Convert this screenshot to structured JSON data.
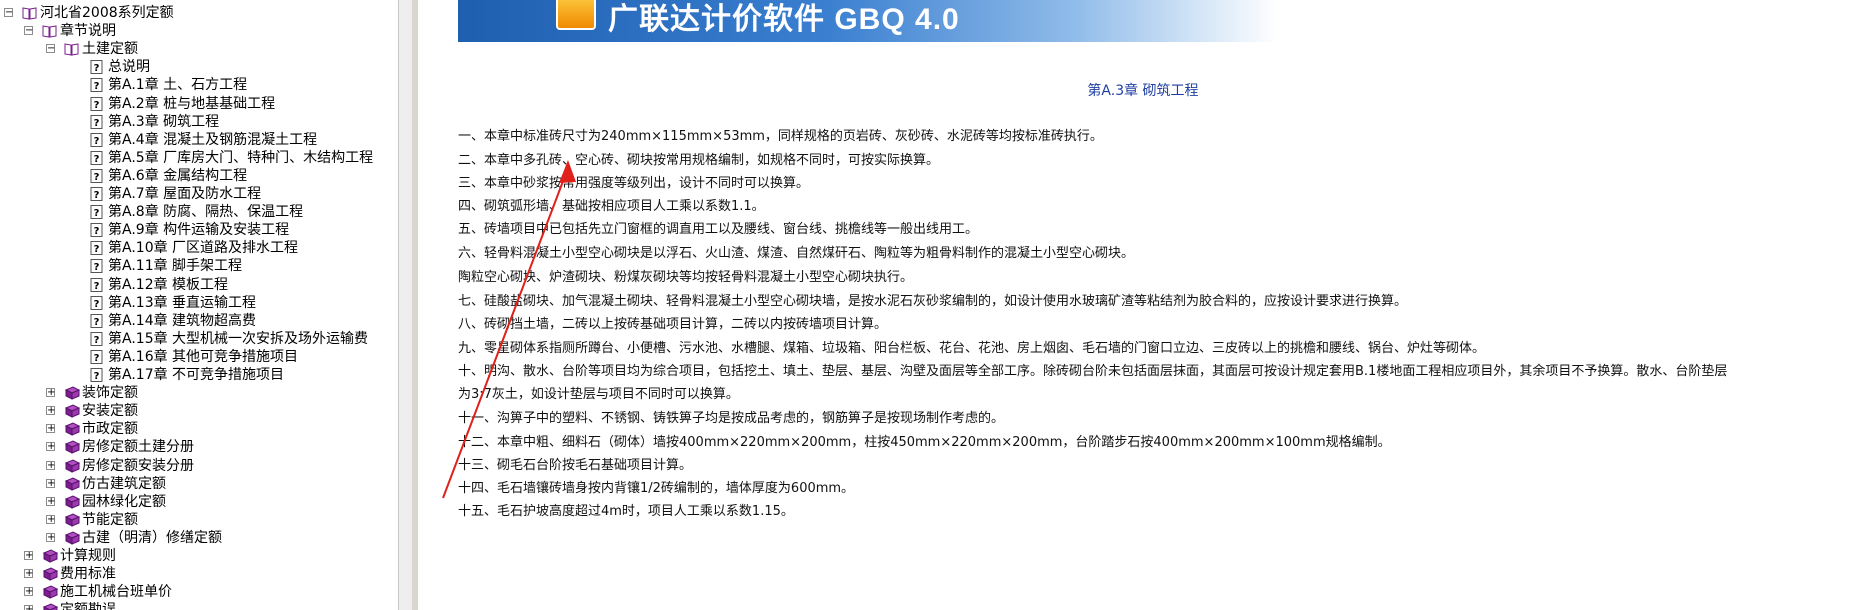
{
  "tree": {
    "items": [
      {
        "label": "河北省2008系列定额",
        "level": 0,
        "expander": "⊟",
        "icon": "book-open-icon"
      },
      {
        "label": "章节说明",
        "level": 1,
        "expander": "⊟",
        "icon": "book-open-icon"
      },
      {
        "label": "土建定额",
        "level": 2,
        "expander": "⊟",
        "icon": "book-open-icon"
      },
      {
        "label": "总说明",
        "level": 3,
        "expander": "",
        "icon": "help-page-icon"
      },
      {
        "label": "第A.1章 土、石方工程",
        "level": 3,
        "expander": "",
        "icon": "help-page-icon"
      },
      {
        "label": "第A.2章 桩与地基基础工程",
        "level": 3,
        "expander": "",
        "icon": "help-page-icon"
      },
      {
        "label": "第A.3章 砌筑工程",
        "level": 3,
        "expander": "",
        "icon": "help-page-icon"
      },
      {
        "label": "第A.4章 混凝土及钢筋混凝土工程",
        "level": 3,
        "expander": "",
        "icon": "help-page-icon"
      },
      {
        "label": "第A.5章 厂库房大门、特种门、木结构工程",
        "level": 3,
        "expander": "",
        "icon": "help-page-icon"
      },
      {
        "label": "第A.6章 金属结构工程",
        "level": 3,
        "expander": "",
        "icon": "help-page-icon"
      },
      {
        "label": "第A.7章 屋面及防水工程",
        "level": 3,
        "expander": "",
        "icon": "help-page-icon"
      },
      {
        "label": "第A.8章 防腐、隔热、保温工程",
        "level": 3,
        "expander": "",
        "icon": "help-page-icon"
      },
      {
        "label": "第A.9章 构件运输及安装工程",
        "level": 3,
        "expander": "",
        "icon": "help-page-icon"
      },
      {
        "label": "第A.10章 厂区道路及排水工程",
        "level": 3,
        "expander": "",
        "icon": "help-page-icon"
      },
      {
        "label": "第A.11章 脚手架工程",
        "level": 3,
        "expander": "",
        "icon": "help-page-icon"
      },
      {
        "label": "第A.12章 模板工程",
        "level": 3,
        "expander": "",
        "icon": "help-page-icon"
      },
      {
        "label": "第A.13章 垂直运输工程",
        "level": 3,
        "expander": "",
        "icon": "help-page-icon"
      },
      {
        "label": "第A.14章 建筑物超高费",
        "level": 3,
        "expander": "",
        "icon": "help-page-icon"
      },
      {
        "label": "第A.15章 大型机械一次安拆及场外运输费",
        "level": 3,
        "expander": "",
        "icon": "help-page-icon"
      },
      {
        "label": "第A.16章 其他可竞争措施项目",
        "level": 3,
        "expander": "",
        "icon": "help-page-icon"
      },
      {
        "label": "第A.17章 不可竞争措施项目",
        "level": 3,
        "expander": "",
        "icon": "help-page-icon"
      },
      {
        "label": "装饰定额",
        "level": 2,
        "expander": "⊞",
        "icon": "book-closed-icon"
      },
      {
        "label": "安装定额",
        "level": 2,
        "expander": "⊞",
        "icon": "book-closed-icon"
      },
      {
        "label": "市政定额",
        "level": 2,
        "expander": "⊞",
        "icon": "book-closed-icon"
      },
      {
        "label": "房修定额土建分册",
        "level": 2,
        "expander": "⊞",
        "icon": "book-closed-icon"
      },
      {
        "label": "房修定额安装分册",
        "level": 2,
        "expander": "⊞",
        "icon": "book-closed-icon"
      },
      {
        "label": "仿古建筑定额",
        "level": 2,
        "expander": "⊞",
        "icon": "book-closed-icon"
      },
      {
        "label": "园林绿化定额",
        "level": 2,
        "expander": "⊞",
        "icon": "book-closed-icon"
      },
      {
        "label": "节能定额",
        "level": 2,
        "expander": "⊞",
        "icon": "book-closed-icon"
      },
      {
        "label": "古建（明清）修缮定额",
        "level": 2,
        "expander": "⊞",
        "icon": "book-closed-icon"
      },
      {
        "label": "计算规则",
        "level": 1,
        "expander": "⊞",
        "icon": "book-closed-icon"
      },
      {
        "label": "费用标准",
        "level": 1,
        "expander": "⊞",
        "icon": "book-closed-icon"
      },
      {
        "label": "施工机械台班单价",
        "level": 1,
        "expander": "⊞",
        "icon": "book-closed-icon"
      },
      {
        "label": "定额勘误",
        "level": 1,
        "expander": "⊞",
        "icon": "book-closed-icon"
      }
    ]
  },
  "banner": {
    "text": "广联达计价软件 GBQ 4.0"
  },
  "content": {
    "title": "第A.3章 砌筑工程",
    "paragraphs": [
      "一、本章中标准砖尺寸为240mm×115mm×53mm，同样规格的页岩砖、灰砂砖、水泥砖等均按标准砖执行。",
      "二、本章中多孔砖、空心砖、砌块按常用规格编制，如规格不同时，可按实际换算。",
      "三、本章中砂浆按常用强度等级列出，设计不同时可以换算。",
      "四、砌筑弧形墙、基础按相应项目人工乘以系数1.1。",
      "五、砖墙项目中已包括先立门窗框的调直用工以及腰线、窗台线、挑檐线等一般出线用工。",
      "六、轻骨料混凝土小型空心砌块是以浮石、火山渣、煤渣、自然煤矸石、陶粒等为粗骨料制作的混凝土小型空心砌块。",
      "陶粒空心砌块、炉渣砌块、粉煤灰砌块等均按轻骨料混凝土小型空心砌块执行。",
      "七、硅酸盐砌块、加气混凝土砌块、轻骨料混凝土小型空心砌块墙，是按水泥石灰砂浆编制的，如设计使用水玻璃矿渣等粘结剂为胶合料的，应按设计要求进行换算。",
      "八、砖砌挡土墙，二砖以上按砖基础项目计算，二砖以内按砖墙项目计算。",
      "九、零星砌体系指厕所蹲台、小便槽、污水池、水槽腿、煤箱、垃圾箱、阳台栏板、花台、花池、房上烟囱、毛石墙的门窗口立边、三皮砖以上的挑檐和腰线、锅台、炉灶等砌体。",
      "十、明沟、散水、台阶等项目均为综合项目，包括挖土、填土、垫层、基层、沟壁及面层等全部工序。除砖砌台阶未包括面层抹面，其面层可按设计规定套用B.1楼地面工程相应项目外，其余项目不予换算。散水、台阶垫层",
      "为3:7灰土，如设计垫层与项目不同时可以换算。",
      "十一、沟箅子中的塑料、不锈钢、铸铁箅子均是按成品考虑的，钢筋箅子是按现场制作考虑的。",
      "十二、本章中粗、细料石（砌体）墙按400mm×220mm×200mm，柱按450mm×220mm×200mm，台阶踏步石按400mm×200mm×100mm规格编制。",
      "十三、砌毛石台阶按毛石基础项目计算。",
      "十四、毛石墙镶砖墙身按内背镶1/2砖编制的，墙体厚度为600mm。",
      "十五、毛石护坡高度超过4m时，项目人工乘以系数1.15。"
    ]
  },
  "colors": {
    "title": "#1f3fa3",
    "arrow": "#e0201a",
    "book": "#7a1f8c"
  }
}
